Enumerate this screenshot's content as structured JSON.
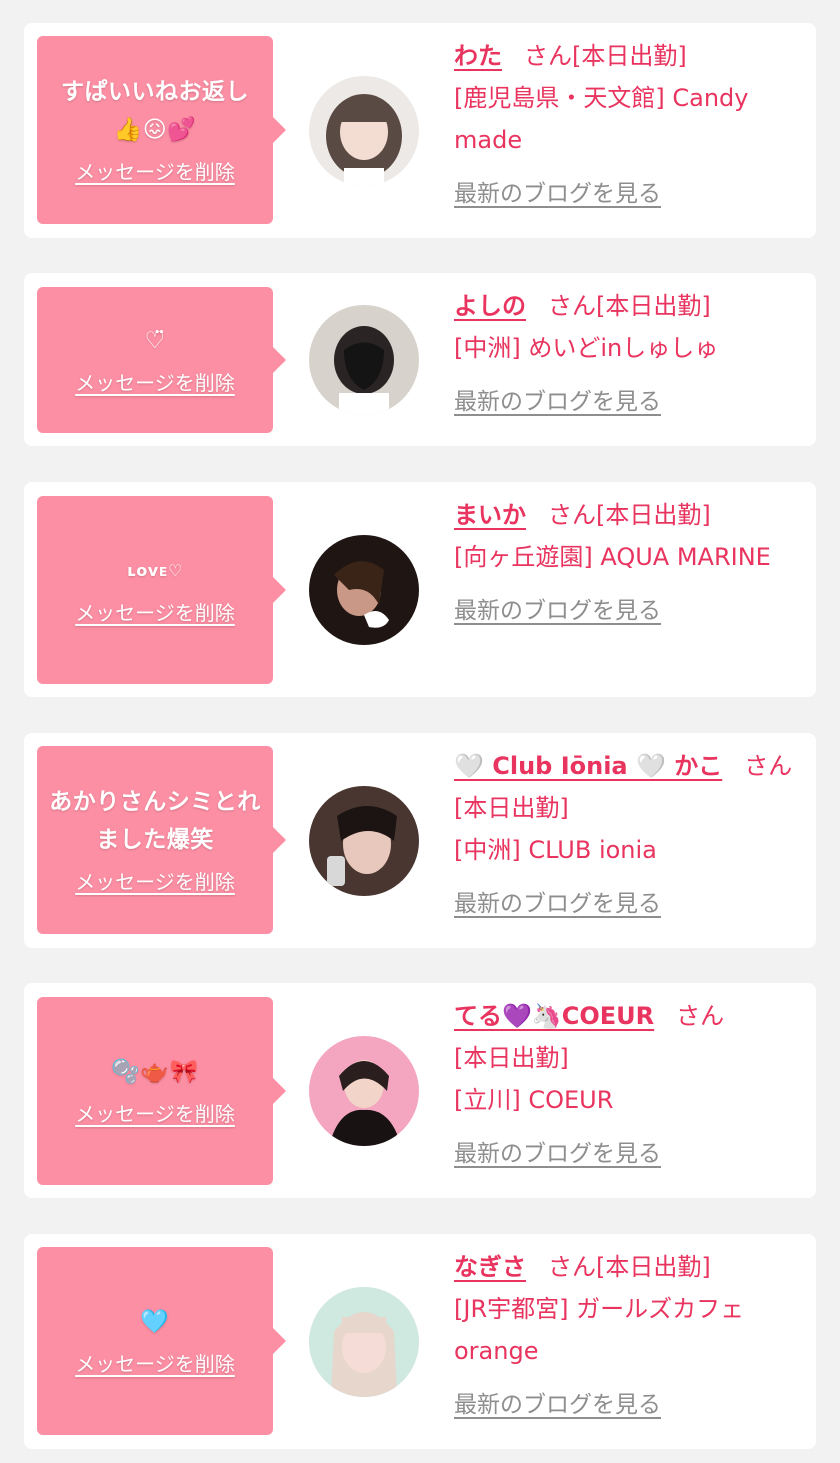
{
  "cards": [
    {
      "message": "すぱいいねお返し👍😖💕",
      "delete_label": "メッセージを削除",
      "name": "わた",
      "honorific": "さん",
      "status": "[本日出勤]",
      "shop": "[鹿児島県・天文館] Candy made",
      "blog_label": "最新のブログを見る"
    },
    {
      "message": "♡̈",
      "delete_label": "メッセージを削除",
      "name": "よしの",
      "honorific": "さん",
      "status": "[本日出勤]",
      "shop": "[中洲] めいどinしゅしゅ",
      "blog_label": "最新のブログを見る"
    },
    {
      "message": "ʟᴏᴠᴇ♡",
      "delete_label": "メッセージを削除",
      "name": "まいか",
      "honorific": "さん",
      "status": "[本日出勤]",
      "shop": "[向ヶ丘遊園] AQUA MARINE",
      "blog_label": "最新のブログを見る"
    },
    {
      "message": "あかりさんシミとれました爆笑",
      "delete_label": "メッセージを削除",
      "name": "🤍 Club Iōnia 🤍 かこ",
      "honorific": "さん",
      "status": "[本日出勤]",
      "shop": "[中洲] CLUB ionia",
      "blog_label": "最新のブログを見る"
    },
    {
      "message": "🫧🫖🎀",
      "delete_label": "メッセージを削除",
      "name": "てる💜🦄COEUR",
      "honorific": "さん",
      "status": "[本日出勤]",
      "shop": "[立川] COEUR",
      "blog_label": "最新のブログを見る"
    },
    {
      "message": "🩵",
      "delete_label": "メッセージを削除",
      "name": "なぎさ",
      "honorific": "さん",
      "status": "[本日出勤]",
      "shop": "[JR宇都宮] ガールズカフェ orange",
      "blog_label": "最新のブログを見る"
    }
  ],
  "colors": {
    "accent_pink": "#e8345e",
    "bubble_pink": "#fd8fa4",
    "link_gray": "#8e8e8e",
    "page_bg": "#f2f2f2"
  }
}
